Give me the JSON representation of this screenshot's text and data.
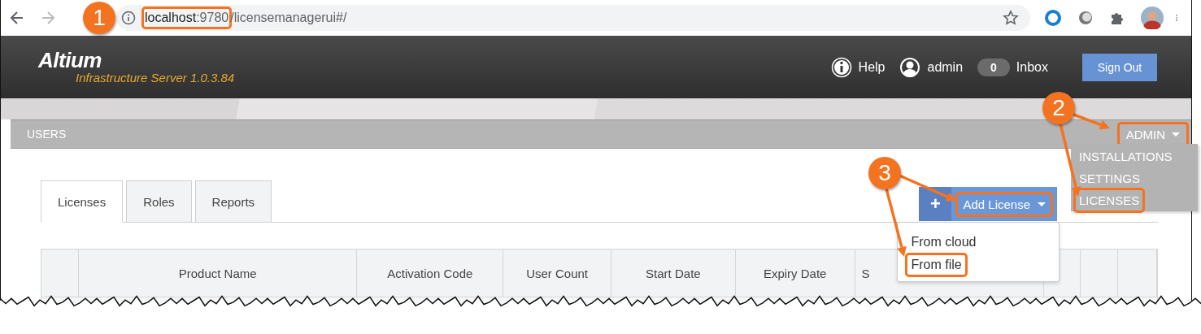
{
  "browser": {
    "url": [
      {
        "text": "localhost",
        "emphasis": true,
        "highlighted": true
      },
      {
        "text": ":9780",
        "emphasis": false,
        "highlighted": true
      },
      {
        "text": "/licensemanagerui#/",
        "emphasis": false,
        "highlighted": false
      }
    ]
  },
  "header": {
    "logo": "Altium",
    "product": "Infrastructure Server 1.0.3.84",
    "help": "Help",
    "user": "admin",
    "inbox_count": "0",
    "inbox": "Inbox",
    "sign_out": "Sign Out"
  },
  "section_bar": {
    "title": "USERS",
    "admin_menu": {
      "label": "ADMIN",
      "highlighted": true,
      "expanded": true,
      "items": [
        {
          "label": "INSTALLATIONS",
          "highlighted": false
        },
        {
          "label": "SETTINGS",
          "highlighted": false
        },
        {
          "label": "LICENSES",
          "highlighted": true
        }
      ]
    }
  },
  "tabs": [
    {
      "label": "Licenses",
      "selected": true
    },
    {
      "label": "Roles",
      "selected": false
    },
    {
      "label": "Reports",
      "selected": false
    }
  ],
  "add_license": {
    "plus": "+",
    "label": "Add License",
    "highlighted": true,
    "expanded": true,
    "items": [
      {
        "label": "From cloud",
        "highlighted": false
      },
      {
        "label": "From file",
        "highlighted": true
      }
    ]
  },
  "table": {
    "columns": [
      {
        "kind": "blank"
      },
      {
        "kind": "text",
        "label": "Product Name"
      },
      {
        "kind": "text",
        "label": "Activation Code"
      },
      {
        "kind": "text",
        "label": "User Count"
      },
      {
        "kind": "text",
        "label": "Start Date"
      },
      {
        "kind": "text",
        "label": "Expiry Date"
      },
      {
        "kind": "text",
        "label": "S"
      },
      {
        "kind": "blank"
      },
      {
        "kind": "blank"
      },
      {
        "kind": "blank"
      }
    ]
  },
  "callouts": [
    {
      "number": "1"
    },
    {
      "number": "2"
    },
    {
      "number": "3"
    }
  ]
}
